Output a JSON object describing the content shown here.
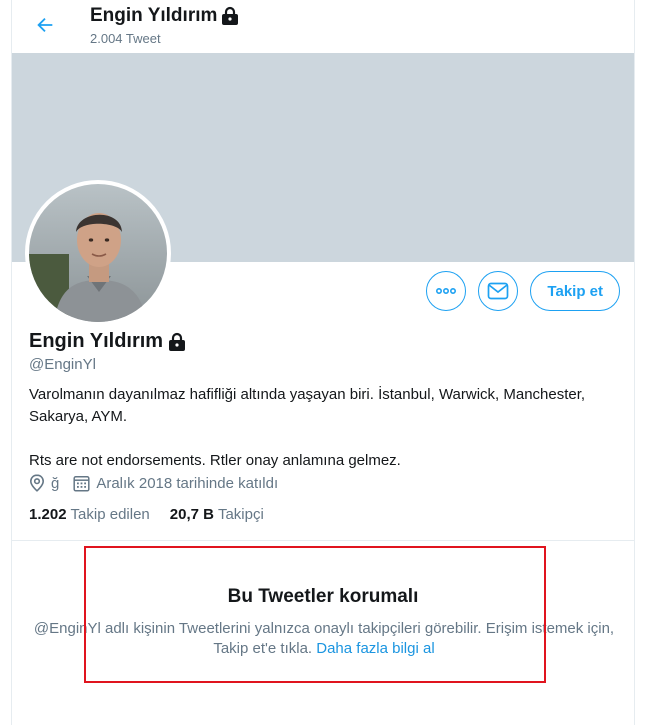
{
  "header": {
    "name": "Engin Yıldırım",
    "tweet_count": "2.004 Tweet"
  },
  "profile": {
    "name": "Engin Yıldırım",
    "handle": "@EnginYl",
    "bio_line1": "Varolmanın dayanılmaz hafifliği altında yaşayan biri. İstanbul, Warwick, Manchester, Sakarya, AYM.",
    "bio_line2": "Rts are not endorsements. Rtler onay anlamına gelmez.",
    "location": "ğ",
    "joined": "Aralık 2018 tarihinde katıldı"
  },
  "actions": {
    "follow_label": "Takip et"
  },
  "stats": {
    "following_count": "1.202",
    "following_label": "Takip edilen",
    "followers_count": "20,7 B",
    "followers_label": "Takipçi"
  },
  "protected": {
    "title": "Bu Tweetler korumalı",
    "description": "@EnginYl adlı kişinin Tweetlerini yalnızca onaylı takipçileri görebilir. Erişim istemek için, Takip et'e tıkla.",
    "learn_more": "Daha fazla bilgi al"
  },
  "colors": {
    "accent": "#1da1f2",
    "link": "#1b95e0",
    "secondary_text": "#657786",
    "banner": "#ccd6dd",
    "highlight_box": "#e0141e"
  },
  "icons": [
    "back-arrow-icon",
    "lock-icon",
    "more-icon",
    "mail-icon",
    "location-icon",
    "calendar-icon"
  ]
}
